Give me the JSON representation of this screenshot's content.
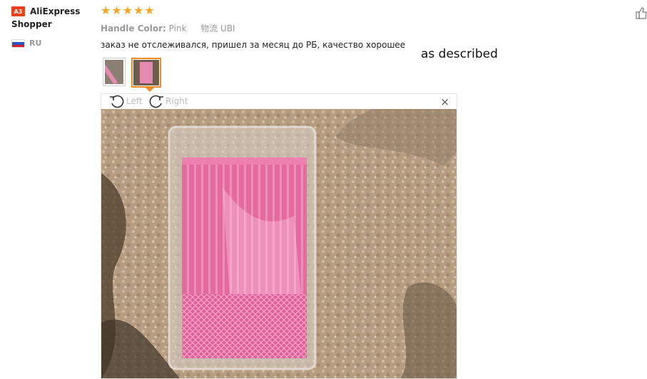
{
  "user": {
    "avatar_initials": "A3",
    "name": "AliExpress Shopper",
    "country": "RU",
    "avatar_color": "#e8401b"
  },
  "review": {
    "rating": 5,
    "rating_max": 5,
    "attr_handle_label": "Handle Color:",
    "attr_handle_value": "Pink",
    "attr_shipping_label": "物流",
    "attr_shipping_value": "UBI",
    "text": "заказ не отслеживался, пришел за месяц до РБ, качество хорошее",
    "star_color": "#f5a623"
  },
  "overlay_note": "as described",
  "viewer": {
    "rotate_left_label": "Left",
    "rotate_right_label": "Right",
    "close_icon": "×",
    "active_thumb_color": "#f08a24"
  }
}
